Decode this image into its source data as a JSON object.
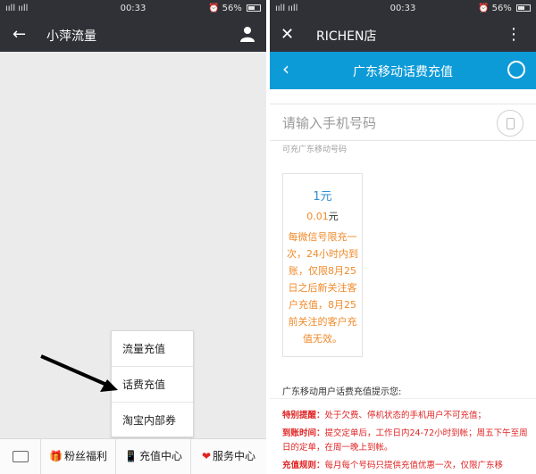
{
  "status": {
    "signal": "ııll ııll",
    "time": "00:33",
    "battery": "56%",
    "battery_level": 0.56
  },
  "left": {
    "title": "小萍流量",
    "popup": {
      "items": [
        "流量充值",
        "话费充值",
        "淘宝内部券"
      ]
    },
    "bottom_menu": [
      {
        "icon": "gift-icon",
        "label": "粉丝福利"
      },
      {
        "icon": "phone-icon",
        "label": "充值中心"
      },
      {
        "icon": "heart-icon",
        "label": "服务中心"
      }
    ]
  },
  "right": {
    "title": "RICHEN店",
    "page_title": "广东移动话费充值",
    "phone_placeholder": "请输入手机号码",
    "hint": "可充广东移动号码",
    "card": {
      "face": "1元",
      "price": "0.01",
      "price_unit": "元",
      "desc": "每微信号限充一次，24小时内到账，仅限8月25日之后新关注客户充值，8月25前关注的客户充值无效。"
    },
    "tips_title": "广东移动用户话费充值提示您:",
    "tips": [
      {
        "key": "特别提醒：",
        "value": "处于欠费、停机状态的手机用户不可充值；"
      },
      {
        "key": "到账时间：",
        "value": "提交定单后，工作日内24-72小时到帐；周五下午至周日的定单，在周一晚上到帐。"
      },
      {
        "key": "充值规则：",
        "value": "每月每个号码只提供充值优惠一次，仅限广东移"
      }
    ]
  }
}
